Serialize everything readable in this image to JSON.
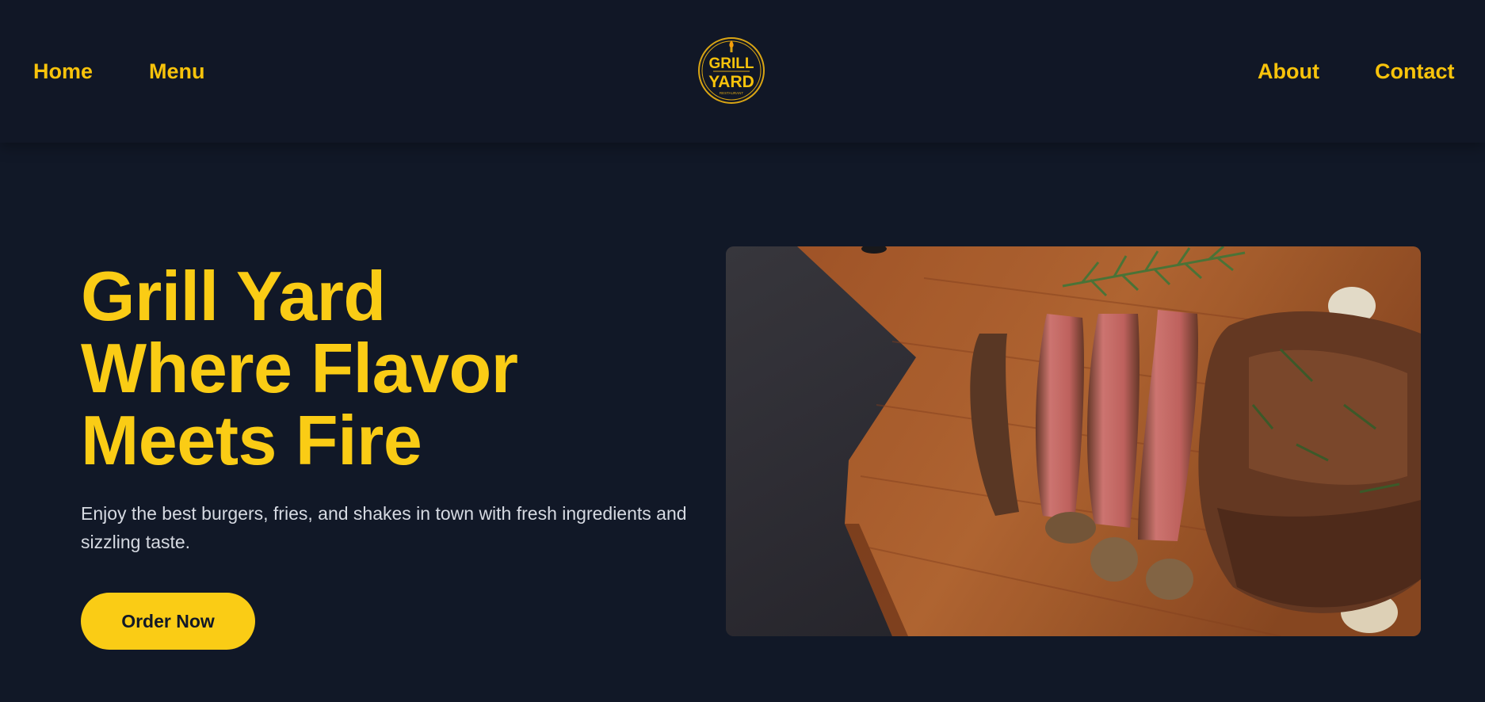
{
  "nav": {
    "home": "Home",
    "menu": "Menu",
    "about": "About",
    "contact": "Contact"
  },
  "logo": {
    "line1": "GRILL",
    "line2": "YARD",
    "line3": "RESTAURANT",
    "icon": "torch-flame-icon"
  },
  "hero": {
    "title_line1": "Grill Yard",
    "title_line2": "Where Flavor",
    "title_line3": "Meets Fire",
    "subtitle": "Enjoy the best burgers, fries, and shakes in town with fresh ingredients and sizzling taste.",
    "cta": "Order Now",
    "image": "sliced steak on wooden cutting board with rosemary and garlic"
  },
  "colors": {
    "background": "#111827",
    "accent": "#facc15",
    "text_muted": "#d6dae2"
  }
}
